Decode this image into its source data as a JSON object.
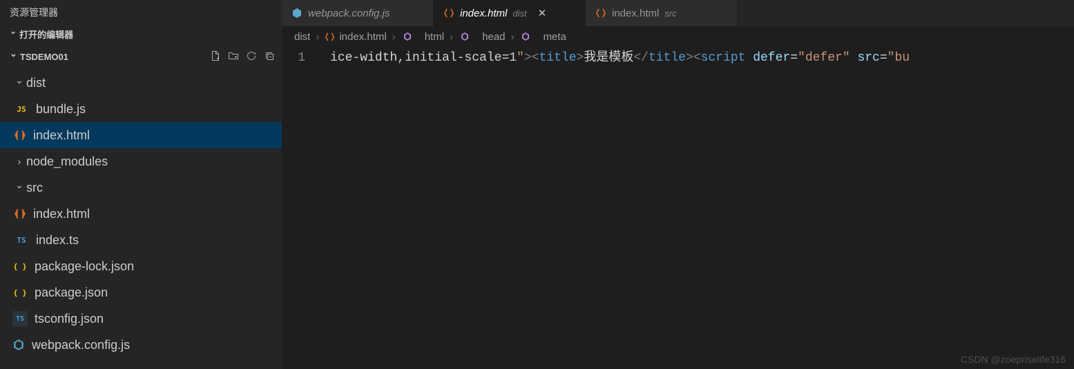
{
  "sidebar": {
    "explorer_title": "资源管理器",
    "open_editors_title": "打开的编辑器",
    "project_name": "TSDEMO01",
    "actions_aria": {
      "new_file": "new-file",
      "new_folder": "new-folder",
      "refresh": "refresh",
      "collapse": "collapse-all"
    },
    "tree": [
      {
        "type": "folder",
        "name": "dist",
        "expanded": true,
        "depth": 1
      },
      {
        "type": "file",
        "name": "bundle.js",
        "icon": "js",
        "depth": 2,
        "selected": false
      },
      {
        "type": "file",
        "name": "index.html",
        "icon": "html",
        "depth": 2,
        "selected": true
      },
      {
        "type": "folder",
        "name": "node_modules",
        "expanded": false,
        "depth": 1
      },
      {
        "type": "folder",
        "name": "src",
        "expanded": true,
        "depth": 1
      },
      {
        "type": "file",
        "name": "index.html",
        "icon": "html",
        "depth": 2,
        "selected": false
      },
      {
        "type": "file",
        "name": "index.ts",
        "icon": "ts",
        "depth": 2,
        "selected": false
      },
      {
        "type": "file",
        "name": "package-lock.json",
        "icon": "json",
        "depth": 1,
        "selected": false
      },
      {
        "type": "file",
        "name": "package.json",
        "icon": "json",
        "depth": 1,
        "selected": false
      },
      {
        "type": "file",
        "name": "tsconfig.json",
        "icon": "tsconfig",
        "depth": 1,
        "selected": false
      },
      {
        "type": "file",
        "name": "webpack.config.js",
        "icon": "webpack",
        "depth": 1,
        "selected": false
      }
    ]
  },
  "tabs": [
    {
      "icon": "webpack",
      "label": "webpack.config.js",
      "dir": "",
      "active": false,
      "italic": true,
      "close": false
    },
    {
      "icon": "html",
      "label": "index.html",
      "dir": "dist",
      "active": true,
      "italic": true,
      "close": true
    },
    {
      "icon": "html",
      "label": "index.html",
      "dir": "src",
      "active": false,
      "italic": false,
      "close": false
    }
  ],
  "breadcrumbs": [
    {
      "label": "dist",
      "icon": ""
    },
    {
      "label": "index.html",
      "icon": "html"
    },
    {
      "label": "html",
      "icon": "symbol"
    },
    {
      "label": "head",
      "icon": "symbol"
    },
    {
      "label": "meta",
      "icon": "symbol"
    }
  ],
  "editor": {
    "line_number": "1",
    "segments": [
      {
        "cls": "plain",
        "t": "ice-width,initial-scale=1"
      },
      {
        "cls": "str",
        "t": "\""
      },
      {
        "cls": "punc",
        "t": ">"
      },
      {
        "cls": "punc",
        "t": "<"
      },
      {
        "cls": "tag",
        "t": "title"
      },
      {
        "cls": "punc",
        "t": ">"
      },
      {
        "cls": "text",
        "t": "我是模板"
      },
      {
        "cls": "punc",
        "t": "</"
      },
      {
        "cls": "tag",
        "t": "title"
      },
      {
        "cls": "punc",
        "t": ">"
      },
      {
        "cls": "punc",
        "t": "<"
      },
      {
        "cls": "tag",
        "t": "script"
      },
      {
        "cls": "plain",
        "t": " "
      },
      {
        "cls": "attr",
        "t": "defer"
      },
      {
        "cls": "plain",
        "t": "="
      },
      {
        "cls": "str",
        "t": "\"defer\""
      },
      {
        "cls": "plain",
        "t": " "
      },
      {
        "cls": "attr",
        "t": "src"
      },
      {
        "cls": "plain",
        "t": "="
      },
      {
        "cls": "str",
        "t": "\"bu"
      }
    ]
  },
  "watermark": "CSDN @zoepriselife316"
}
